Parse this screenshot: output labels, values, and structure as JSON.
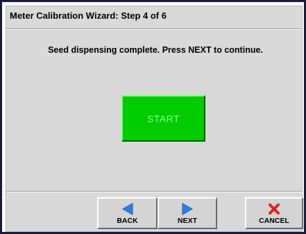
{
  "dialog": {
    "title": "Meter Calibration Wizard:  Step 4 of 6",
    "message": "Seed dispensing complete. Press NEXT to continue."
  },
  "start_button": {
    "label": "START",
    "color": "#00cc00"
  },
  "nav": {
    "back": {
      "label": "BACK",
      "icon": "left-arrow-icon",
      "color": "#2d7fe6"
    },
    "next": {
      "label": "NEXT",
      "icon": "right-arrow-icon",
      "color": "#2d7fe6"
    },
    "cancel": {
      "label": "CANCEL",
      "icon": "close-x-icon",
      "color": "#e02020"
    }
  }
}
